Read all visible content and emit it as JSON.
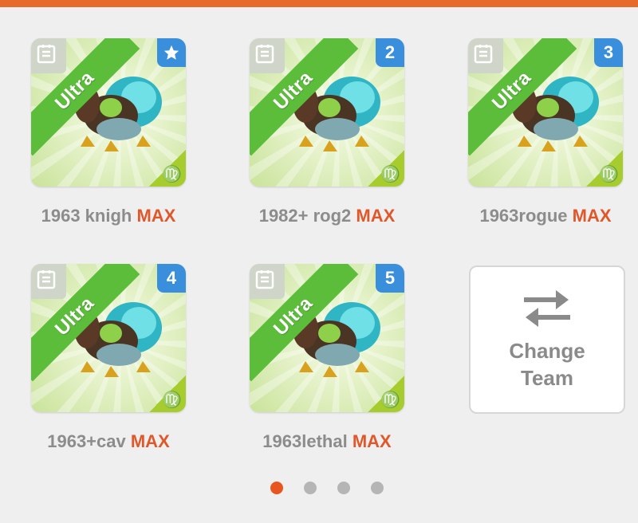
{
  "colors": {
    "accent": "#e86a2a",
    "max": "#e0572a",
    "ribbon": "#5cbd3b",
    "badge": "#3a8fdc",
    "zodiac": "#a6cc2e"
  },
  "team": [
    {
      "tier": "Ultra",
      "slot_badge_icon": "star-icon",
      "slot": "",
      "name": "1963 knigh",
      "level": "MAX",
      "zodiac": "♍"
    },
    {
      "tier": "Ultra",
      "slot": "2",
      "name": "1982+ rog2",
      "level": "MAX",
      "zodiac": "♍"
    },
    {
      "tier": "Ultra",
      "slot": "3",
      "name": "1963rogue",
      "level": "MAX",
      "zodiac": "♍"
    },
    {
      "tier": "Ultra",
      "slot": "4",
      "name": "1963+cav",
      "level": "MAX",
      "zodiac": "♍"
    },
    {
      "tier": "Ultra",
      "slot": "5",
      "name": "1963lethal",
      "level": "MAX",
      "zodiac": "♍"
    }
  ],
  "change_team": {
    "line1": "Change",
    "line2": "Team",
    "icon": "swap-arrows-icon"
  },
  "pagination": {
    "current": 1,
    "total": 4
  }
}
